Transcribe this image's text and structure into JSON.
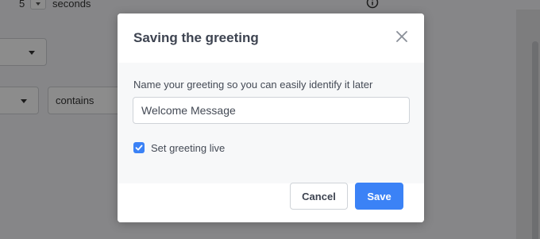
{
  "background": {
    "delay_value": "5",
    "delay_unit": "seconds",
    "condition_operator": "contains"
  },
  "modal": {
    "title": "Saving the greeting",
    "name_label": "Name your greeting so you can easily identify it later",
    "name_value": "Welcome Message",
    "live_checkbox_label": "Set greeting live",
    "live_checked": true,
    "cancel_label": "Cancel",
    "save_label": "Save"
  },
  "colors": {
    "primary": "#3b82f6",
    "title_text": "#3e4451"
  },
  "icons": {
    "close": "close-icon",
    "info": "info-icon",
    "checkbox": "checkmark-icon"
  }
}
